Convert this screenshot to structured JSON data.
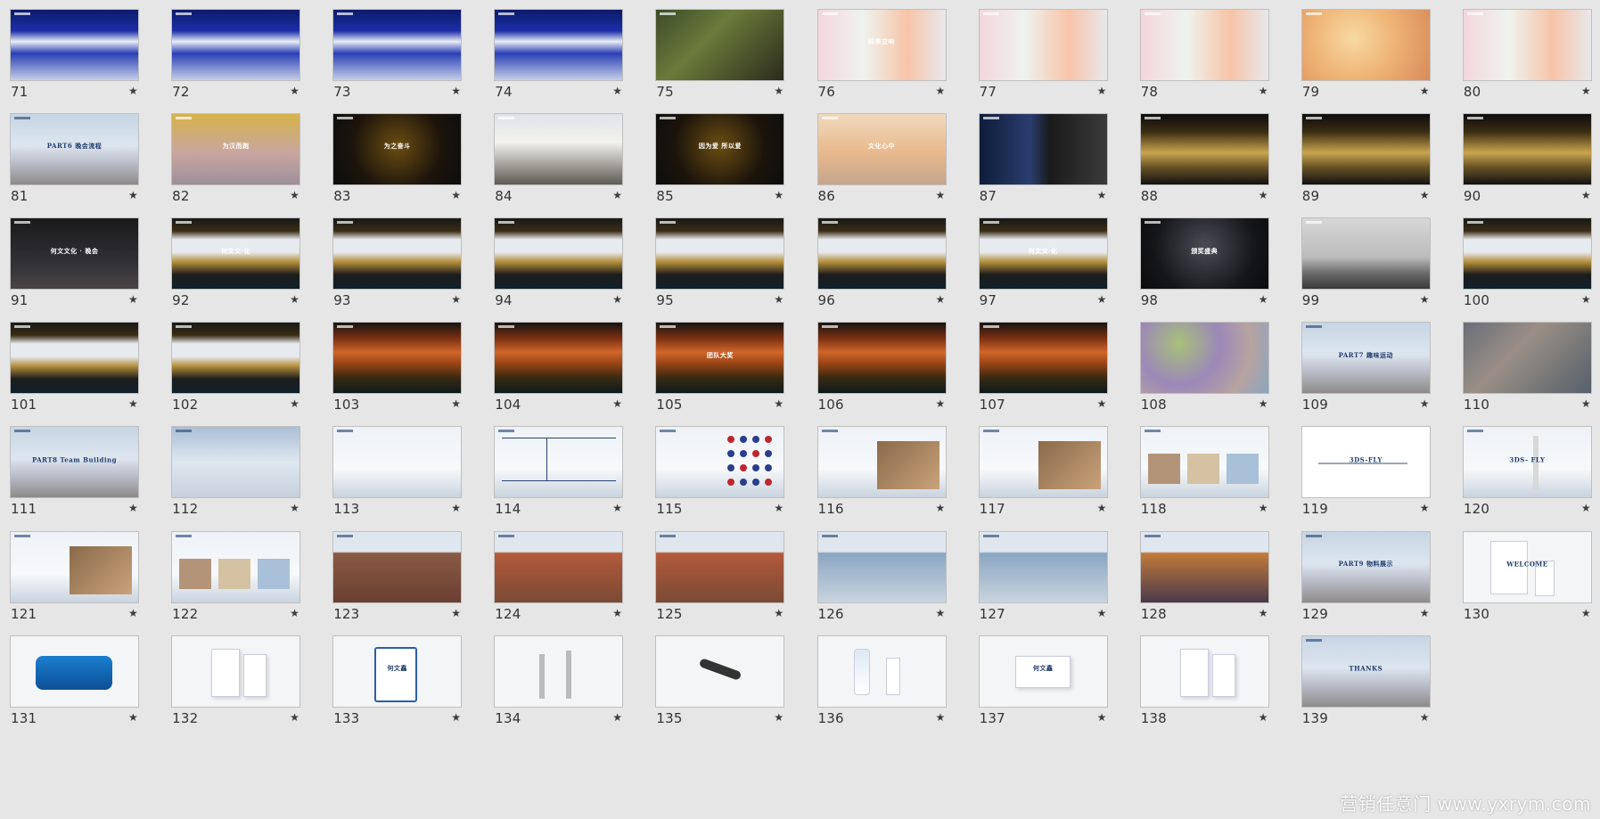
{
  "watermark": "营销任意门 www.yxrym.com",
  "star_glyph": "★",
  "slides": [
    {
      "num": "71",
      "style": "stage-blue",
      "label": ""
    },
    {
      "num": "72",
      "style": "stage-blue",
      "label": ""
    },
    {
      "num": "73",
      "style": "stage-blue",
      "label": ""
    },
    {
      "num": "74",
      "style": "stage-blue",
      "label": ""
    },
    {
      "num": "75",
      "style": "food",
      "label": ""
    },
    {
      "num": "76",
      "style": "floral",
      "label": "四季交响"
    },
    {
      "num": "77",
      "style": "floral",
      "label": ""
    },
    {
      "num": "78",
      "style": "floral",
      "label": ""
    },
    {
      "num": "79",
      "style": "warm-blur",
      "label": ""
    },
    {
      "num": "80",
      "style": "floral",
      "label": ""
    },
    {
      "num": "81",
      "style": "mountain",
      "label": "PART6 晚会流程"
    },
    {
      "num": "82",
      "style": "runner",
      "label": "为汉而跑"
    },
    {
      "num": "83",
      "style": "gold-dark",
      "label": "为之奋斗"
    },
    {
      "num": "84",
      "style": "runners-road",
      "label": ""
    },
    {
      "num": "85",
      "style": "gold-dark",
      "label": "因为爱 所以爱"
    },
    {
      "num": "86",
      "style": "sunset",
      "label": "文化心中"
    },
    {
      "num": "87",
      "style": "fashion",
      "label": ""
    },
    {
      "num": "88",
      "style": "hall-gold",
      "label": ""
    },
    {
      "num": "89",
      "style": "hall-gold",
      "label": ""
    },
    {
      "num": "90",
      "style": "hall-gold",
      "label": ""
    },
    {
      "num": "91",
      "style": "dark-crowd",
      "label": "何文文化 · 晚会"
    },
    {
      "num": "92",
      "style": "hall-screen",
      "label": "何文文·化"
    },
    {
      "num": "93",
      "style": "hall-screen",
      "label": ""
    },
    {
      "num": "94",
      "style": "hall-screen",
      "label": ""
    },
    {
      "num": "95",
      "style": "hall-screen",
      "label": ""
    },
    {
      "num": "96",
      "style": "hall-screen",
      "label": ""
    },
    {
      "num": "97",
      "style": "hall-screen",
      "label": "何文文·化"
    },
    {
      "num": "98",
      "style": "stage-arch",
      "label": "颁奖盛典"
    },
    {
      "num": "99",
      "style": "speaker",
      "label": ""
    },
    {
      "num": "100",
      "style": "hall-screen",
      "label": ""
    },
    {
      "num": "101",
      "style": "hall-screen",
      "label": ""
    },
    {
      "num": "102",
      "style": "hall-screen",
      "label": ""
    },
    {
      "num": "103",
      "style": "hall-orange",
      "label": ""
    },
    {
      "num": "104",
      "style": "hall-orange",
      "label": ""
    },
    {
      "num": "105",
      "style": "hall-orange",
      "label": "团队大奖"
    },
    {
      "num": "106",
      "style": "hall-orange",
      "label": ""
    },
    {
      "num": "107",
      "style": "hall-orange",
      "label": ""
    },
    {
      "num": "108",
      "style": "balls",
      "label": ""
    },
    {
      "num": "109",
      "style": "mountain",
      "label": "PART7 趣味运动"
    },
    {
      "num": "110",
      "style": "crowd",
      "label": ""
    },
    {
      "num": "111",
      "style": "mountain",
      "label": "PART8 Team Building"
    },
    {
      "num": "112",
      "style": "sky-plane",
      "label": ""
    },
    {
      "num": "113",
      "style": "sky-text",
      "label": ""
    },
    {
      "num": "114",
      "style": "sky-table",
      "label": ""
    },
    {
      "num": "115",
      "style": "sky-grid",
      "label": ""
    },
    {
      "num": "116",
      "style": "sky-photo",
      "label": ""
    },
    {
      "num": "117",
      "style": "sky-photo",
      "label": ""
    },
    {
      "num": "118",
      "style": "sky-3img",
      "label": ""
    },
    {
      "num": "119",
      "style": "white-plane",
      "label": "3DS-FLY"
    },
    {
      "num": "120",
      "style": "sky-fly",
      "label": "3DS-     FLY"
    },
    {
      "num": "121",
      "style": "sky-photo",
      "label": ""
    },
    {
      "num": "122",
      "style": "sky-3img",
      "label": ""
    },
    {
      "num": "123",
      "style": "sky-cheer",
      "label": ""
    },
    {
      "num": "124",
      "style": "sky-team",
      "label": ""
    },
    {
      "num": "125",
      "style": "sky-team",
      "label": ""
    },
    {
      "num": "126",
      "style": "sky-planes",
      "label": ""
    },
    {
      "num": "127",
      "style": "sky-planes",
      "label": ""
    },
    {
      "num": "128",
      "style": "sky-sunset",
      "label": ""
    },
    {
      "num": "129",
      "style": "mountain",
      "label": "PART9 物料展示"
    },
    {
      "num": "130",
      "style": "white-sign",
      "label": "WELCOME"
    },
    {
      "num": "131",
      "style": "white-bus",
      "label": ""
    },
    {
      "num": "132",
      "style": "white-box",
      "label": ""
    },
    {
      "num": "133",
      "style": "white-badge",
      "label": "何文鑫"
    },
    {
      "num": "134",
      "style": "white-stand",
      "label": ""
    },
    {
      "num": "135",
      "style": "white-mic",
      "label": ""
    },
    {
      "num": "136",
      "style": "white-water",
      "label": ""
    },
    {
      "num": "137",
      "style": "white-card",
      "label": "何文鑫"
    },
    {
      "num": "138",
      "style": "white-box2",
      "label": ""
    },
    {
      "num": "139",
      "style": "mountain",
      "label": "THANKS"
    }
  ]
}
